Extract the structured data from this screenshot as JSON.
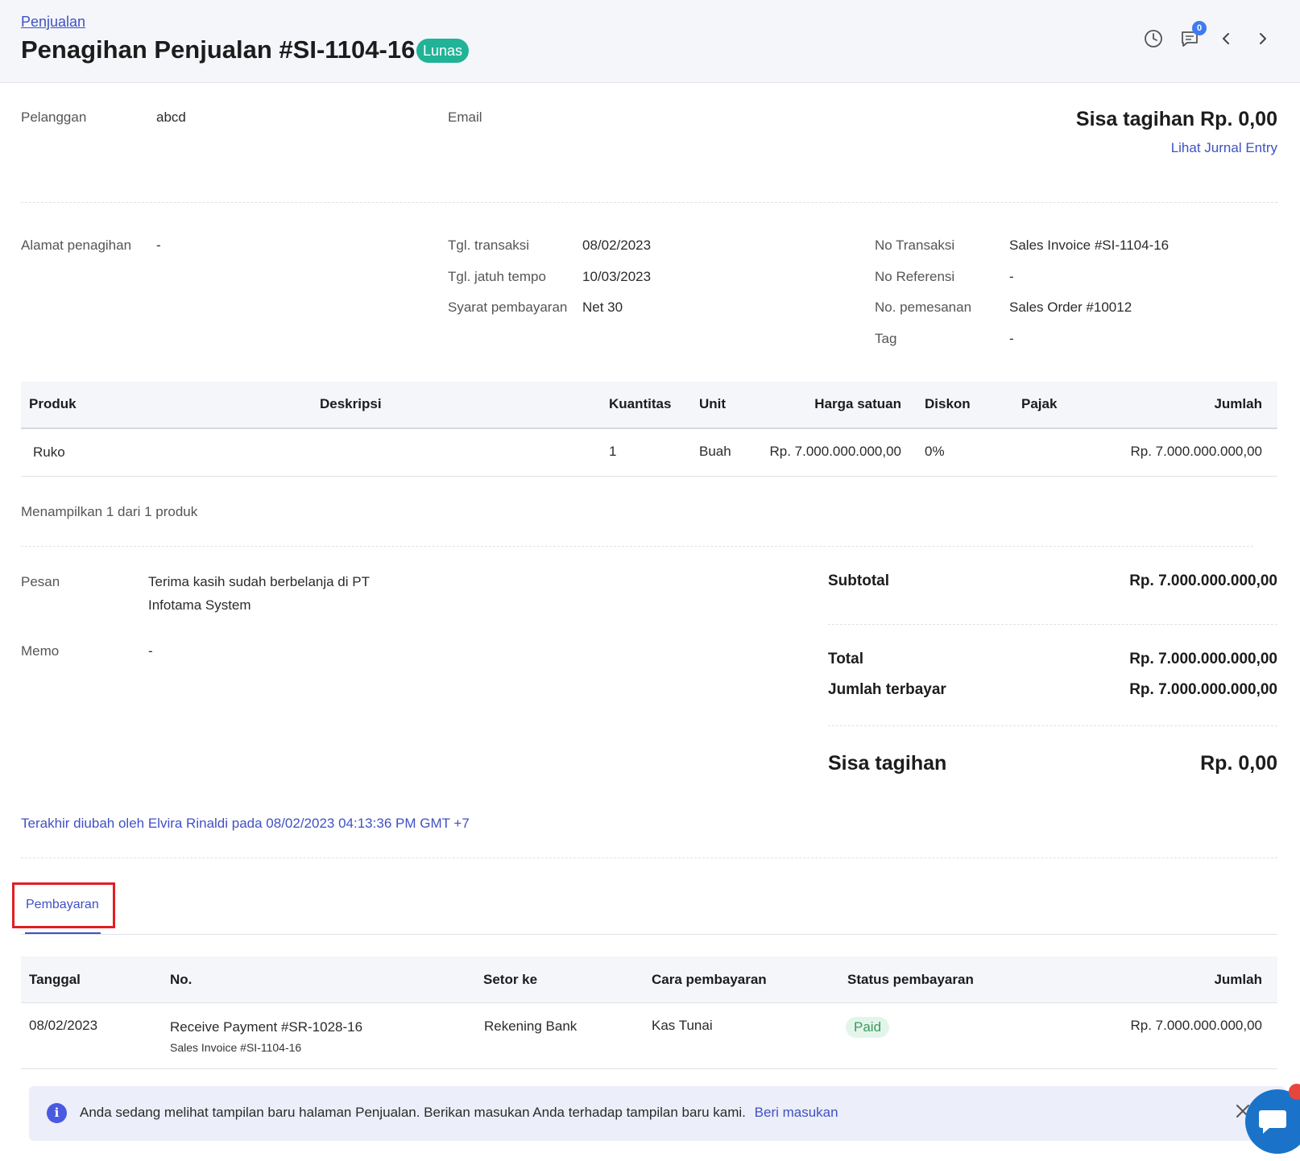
{
  "header": {
    "breadcrumb": "Penjualan",
    "title": "Penagihan Penjualan #SI-1104-16",
    "status_badge": "Lunas",
    "notification_count": "0"
  },
  "summary_top": {
    "customer_label": "Pelanggan",
    "customer_value": "abcd",
    "email_label": "Email",
    "balance_due": "Sisa tagihan Rp. 0,00",
    "journal_link": "Lihat Jurnal Entry"
  },
  "details": {
    "billing_address_label": "Alamat penagihan",
    "billing_address_value": "-",
    "transaction_date_label": "Tgl. transaksi",
    "transaction_date_value": "08/02/2023",
    "due_date_label": "Tgl. jatuh tempo",
    "due_date_value": "10/03/2023",
    "payment_terms_label": "Syarat pembayaran",
    "payment_terms_value": "Net 30",
    "transaction_no_label": "No Transaksi",
    "transaction_no_value": "Sales Invoice #SI-1104-16",
    "reference_no_label": "No Referensi",
    "reference_no_value": "-",
    "order_no_label": "No. pemesanan",
    "order_no_value": "Sales Order #10012",
    "tag_label": "Tag",
    "tag_value": "-"
  },
  "products_table": {
    "headers": [
      "Produk",
      "Deskripsi",
      "Kuantitas",
      "Unit",
      "Harga satuan",
      "Diskon",
      "Pajak",
      "Jumlah"
    ],
    "rows": [
      {
        "product": "Ruko",
        "description": "",
        "qty": "1",
        "unit": "Buah",
        "price": "Rp. 7.000.000.000,00",
        "discount": "0%",
        "tax": "",
        "amount": "Rp. 7.000.000.000,00"
      }
    ],
    "footer": "Menampilkan 1 dari 1 produk"
  },
  "notes": {
    "message_label": "Pesan",
    "message_line1": "Terima kasih sudah berbelanja di PT",
    "message_line2": "Infotama System",
    "memo_label": "Memo",
    "memo_value": "-"
  },
  "totals": {
    "subtotal_label": "Subtotal",
    "subtotal_value": "Rp. 7.000.000.000,00",
    "total_label": "Total",
    "total_value": "Rp. 7.000.000.000,00",
    "paid_label": "Jumlah terbayar",
    "paid_value": "Rp. 7.000.000.000,00",
    "balance_label": "Sisa tagihan",
    "balance_value": "Rp. 0,00"
  },
  "last_modified": "Terakhir diubah oleh Elvira Rinaldi pada 08/02/2023 04:13:36 PM GMT +7",
  "payments": {
    "tab_label": "Pembayaran",
    "headers": [
      "Tanggal",
      "No.",
      "Setor ke",
      "Cara pembayaran",
      "Status pembayaran",
      "Jumlah"
    ],
    "rows": [
      {
        "date": "08/02/2023",
        "number": "Receive Payment #SR-1028-16",
        "sub": "Sales Invoice #SI-1104-16",
        "deposit_to": "Rekening Bank",
        "method": "Kas Tunai",
        "status": "Paid",
        "amount": "Rp. 7.000.000.000,00"
      }
    ]
  },
  "banner": {
    "text": "Anda sedang melihat tampilan baru halaman Penjualan. Berikan masukan Anda terhadap tampilan baru kami.",
    "link": "Beri masukan",
    "info_icon": "i"
  },
  "colors": {
    "accent": "#3f51c4",
    "status_paid_badge": "#21b397",
    "highlight_box": "#e01e24"
  },
  "icons": [
    "history-icon",
    "comment-icon",
    "chevron-left-icon",
    "chevron-right-icon",
    "info-icon",
    "close-icon",
    "chat-icon"
  ]
}
